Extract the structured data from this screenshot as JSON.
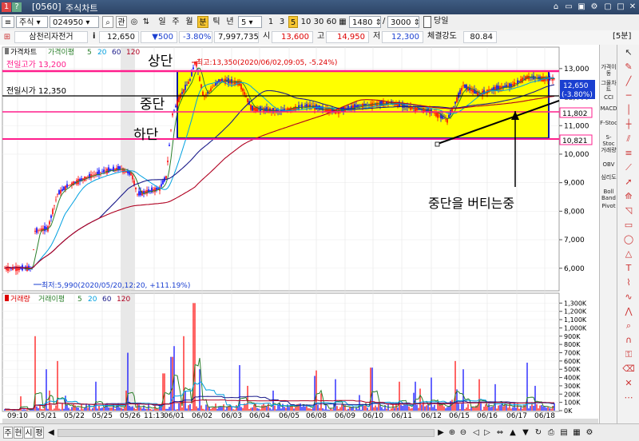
{
  "window": {
    "id": "[0560]",
    "title": "주식차트",
    "icons": [
      "pin-icon",
      "minimize-icon",
      "restore-icon",
      "maximize-icon",
      "close-icon"
    ]
  },
  "toolbar": {
    "market": "주식",
    "code": "024950",
    "btn_gwan": "관",
    "periods": [
      "일",
      "주",
      "월",
      "분",
      "틱",
      "년"
    ],
    "selected_period": "분",
    "period_value": "5",
    "minute_options": [
      "1",
      "3",
      "5",
      "10",
      "30",
      "60"
    ],
    "selected_minute": "5",
    "view_count": "1480",
    "total_count": "3000",
    "today_label": "당일"
  },
  "quote": {
    "name": "삼천리자전거",
    "price": "12,650",
    "change": "▼500",
    "change_pct": "-3.80%",
    "volume": "7,997,735",
    "open_label": "시",
    "open": "13,600",
    "high_label": "고",
    "high": "14,950",
    "low_label": "저",
    "low": "12,300",
    "strength_label": "체결강도",
    "strength": "80.84",
    "interval_badge": "[5분]"
  },
  "price_panel": {
    "legend": [
      "가격차트",
      "가격이평",
      "5",
      "20",
      "60",
      "120"
    ],
    "prev_high_label": "전일고가 13,200",
    "prev_close_label": "전일시가 12,350",
    "max_label": "최고:13,350(2020/06/02,09:05, -5.24%)",
    "min_label": "최저:5,990(2020/05/20,12:20, +111.19%)",
    "annot_top": "상단",
    "annot_mid": "중단",
    "annot_low": "하단",
    "annot_note": "중단을 버티는중",
    "price_tag": "12,650",
    "price_tag_pct": "(-3.80%)",
    "mid_tag": "11,802",
    "low_tag": "10,821",
    "yticks": [
      "13,000",
      "12,000",
      "11,000",
      "10,000",
      "9,000",
      "8,000",
      "7,000",
      "6,000"
    ]
  },
  "volume_panel": {
    "legend": [
      "거래량",
      "거래이평",
      "5",
      "20",
      "60",
      "120"
    ],
    "yticks": [
      "1,300K",
      "1,200K",
      "1,100K",
      "1,000K",
      "900K",
      "800K",
      "700K",
      "600K",
      "500K",
      "400K",
      "300K",
      "200K",
      "100K",
      "0K"
    ]
  },
  "x_axis": {
    "labels": [
      "09:10",
      "05/21",
      "05/22",
      "05/25",
      "05/26",
      "11:13",
      "06/01",
      "06/02",
      "06/03",
      "06/04",
      "06/05",
      "06/08",
      "06/09",
      "06/10",
      "06/11",
      "06/12",
      "06/15",
      "06/16",
      "06/17",
      "06/18"
    ]
  },
  "indicators": [
    "가격이동",
    "그물차트",
    "CCI",
    "MACD",
    "F-Stoc",
    "S-Stoc",
    "거래량",
    "OBV",
    "심리도",
    "Boll Band",
    "Pivot"
  ],
  "bottom_tabs": [
    "주",
    "현",
    "시",
    "평"
  ],
  "colors": {
    "zone_fill": "#ffff00",
    "zone_border": "#0a1aa0",
    "line_magenta": "#ff1e8c",
    "line_black": "#000000",
    "candle_up": "#ff0000",
    "candle_down": "#0000ff",
    "ma5": "#2a7f2a",
    "ma20": "#00a0e0",
    "ma60": "#1a1a8a",
    "ma120": "#b00020",
    "price_tag_bg": "#1a3fd0"
  }
}
